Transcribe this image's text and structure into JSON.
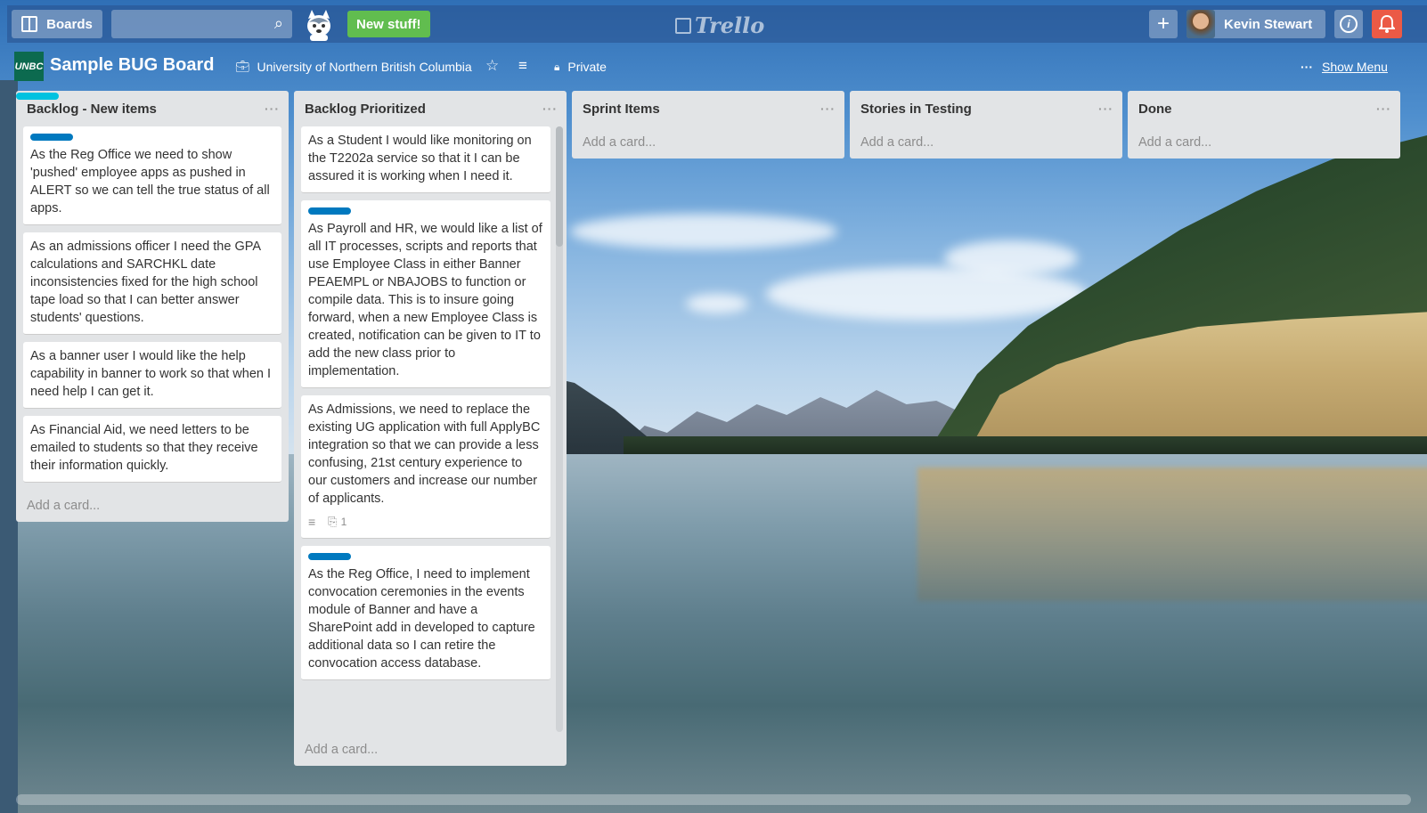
{
  "header": {
    "boards_label": "Boards",
    "new_stuff_label": "New stuff!",
    "logo_text": "Trello",
    "user_name": "Kevin Stewart",
    "plus_label": "+",
    "info_label": "i"
  },
  "board": {
    "title": "Sample BUG Board",
    "org_logo_text": "UNBC",
    "organization": "University of Northern British Columbia",
    "visibility": "Private",
    "show_menu": "Show Menu"
  },
  "lists": [
    {
      "title": "Backlog - New items",
      "menu": "···",
      "cards": [
        {
          "label": "blue",
          "text": "As the Reg Office we need to show 'pushed' employee apps as pushed in ALERT so we can tell the true status of all apps."
        },
        {
          "label": null,
          "text": "As an admissions officer I need the GPA calculations and SARCHKL date inconsistencies fixed for the high school tape load so that I can better answer students' questions."
        },
        {
          "label": "sky",
          "text": "As a banner user I would like the help capability in banner to work so that when I need help I can get it."
        },
        {
          "label": null,
          "text": "As Financial Aid, we need letters to be emailed to students so that they receive their information quickly."
        }
      ],
      "add_card": "Add a card..."
    },
    {
      "title": "Backlog Prioritized",
      "menu": "···",
      "cards": [
        {
          "label": null,
          "text": "As a Student I would like monitoring on the T2202a service so that it I can be assured it is working when I need it."
        },
        {
          "label": "blue",
          "text": "As Payroll and HR, we would like a list of all IT processes, scripts and reports that use Employee Class in either Banner PEAEMPL or NBAJOBS to function or compile data. This is to insure going forward, when a new Employee Class is created, notification can be given to IT to add the new class prior to implementation."
        },
        {
          "label": null,
          "text": "As Admissions, we need to replace the existing UG application with full ApplyBC integration so that we can provide a less confusing, 21st century experience to our customers and increase our number of applicants.",
          "attachments": "1"
        },
        {
          "label": "blue",
          "text": "As the Reg Office, I need to implement convocation ceremonies in the events module of Banner and have a SharePoint add in developed to capture additional data so I can retire the convocation access database."
        }
      ],
      "add_card": "Add a card..."
    },
    {
      "title": "Sprint Items",
      "menu": "···",
      "cards": [],
      "add_card": "Add a card..."
    },
    {
      "title": "Stories in Testing",
      "menu": "···",
      "cards": [],
      "add_card": "Add a card..."
    },
    {
      "title": "Done",
      "menu": "···",
      "cards": [],
      "add_card": "Add a card..."
    }
  ],
  "colors": {
    "label_blue": "#0079bf",
    "label_sky": "#00c2e0",
    "new_stuff_green": "#61bd4f",
    "notification_red": "#eb5a46",
    "unbc_green": "#0c6a4f"
  }
}
